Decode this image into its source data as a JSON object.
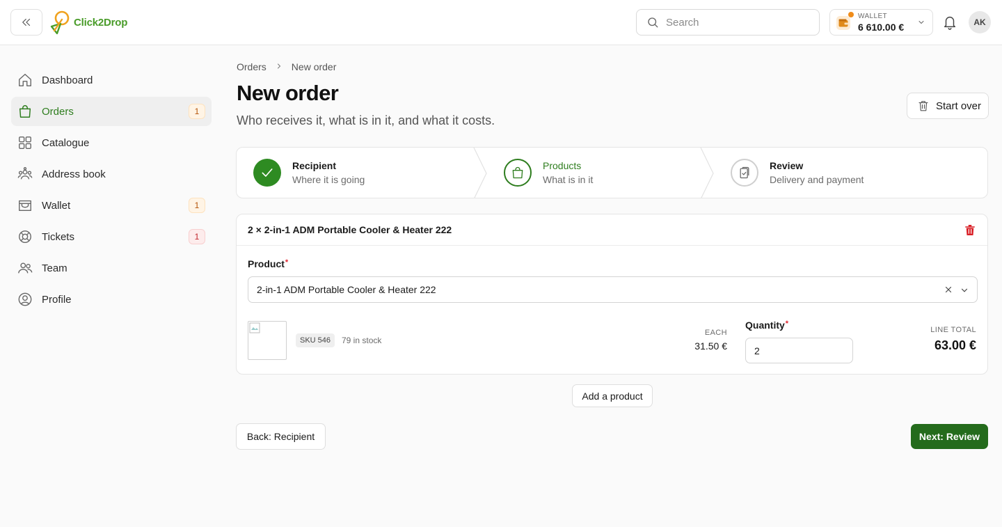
{
  "brand": {
    "name_part1": "Click2",
    "name_part2": "Drop"
  },
  "search": {
    "placeholder": "Search"
  },
  "wallet": {
    "label": "WALLET",
    "balance": "6 610.00 €"
  },
  "user": {
    "initials": "AK"
  },
  "sidebar": {
    "items": [
      {
        "label": "Dashboard",
        "icon": "home-icon",
        "active": false,
        "badge": ""
      },
      {
        "label": "Orders",
        "icon": "shopping-bag-icon",
        "active": true,
        "badge": "1"
      },
      {
        "label": "Catalogue",
        "icon": "grid-icon",
        "active": false,
        "badge": ""
      },
      {
        "label": "Address book",
        "icon": "contacts-icon",
        "active": false,
        "badge": ""
      },
      {
        "label": "Wallet",
        "icon": "wallet-icon",
        "active": false,
        "badge": "1"
      },
      {
        "label": "Tickets",
        "icon": "lifebuoy-icon",
        "active": false,
        "badge": "1"
      },
      {
        "label": "Team",
        "icon": "team-icon",
        "active": false,
        "badge": ""
      },
      {
        "label": "Profile",
        "icon": "user-circle-icon",
        "active": false,
        "badge": ""
      }
    ]
  },
  "breadcrumb": {
    "parent": "Orders",
    "current": "New order"
  },
  "page": {
    "title": "New order",
    "subtitle": "Who receives it, what is in it, and what it costs.",
    "start_over": "Start over"
  },
  "steps": [
    {
      "title": "Recipient",
      "subtitle": "Where it is going",
      "state": "complete"
    },
    {
      "title": "Products",
      "subtitle": "What is in it",
      "state": "current"
    },
    {
      "title": "Review",
      "subtitle": "Delivery and payment",
      "state": "upcoming"
    }
  ],
  "line_item": {
    "header": "2 × 2-in-1 ADM Portable Cooler & Heater 222",
    "product_label": "Product",
    "required_mark": "*",
    "product_value": "2-in-1 ADM Portable Cooler & Heater 222",
    "sku": "SKU 546",
    "stock": "79 in stock",
    "each_label": "EACH",
    "each_value": "31.50 €",
    "quantity_label": "Quantity",
    "quantity_value": "2",
    "line_total_label": "LINE TOTAL",
    "line_total_value": "63.00 €"
  },
  "actions": {
    "add_product": "Add a product",
    "back": "Back: Recipient",
    "next": "Next: Review"
  },
  "colors": {
    "brand_green": "#2e7d1e",
    "primary_button": "#246b1c",
    "danger": "#d91f26",
    "wallet_dot": "#f08c1a"
  }
}
